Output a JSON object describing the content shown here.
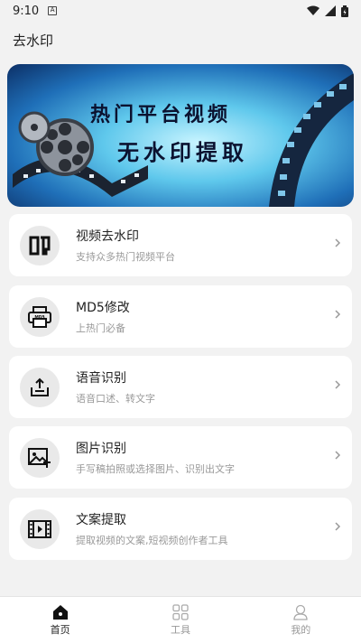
{
  "status_bar": {
    "time": "9:10"
  },
  "app_bar": {
    "title": "去水印"
  },
  "banner": {
    "line1": "热门平台视频",
    "line2": "无水印提取"
  },
  "features": [
    {
      "title": "视频去水印",
      "subtitle": "支持众多热门视频平台",
      "icon": "yin-stamp-icon"
    },
    {
      "title": "MD5修改",
      "subtitle": "上热门必备",
      "icon": "md5-printer-icon"
    },
    {
      "title": "语音识别",
      "subtitle": "语音口述、转文字",
      "icon": "upload-tray-icon"
    },
    {
      "title": "图片识别",
      "subtitle": "手写稿拍照或选择图片、识别出文字",
      "icon": "image-text-icon"
    },
    {
      "title": "文案提取",
      "subtitle": "提取视频的文案,短视频创作者工具",
      "icon": "film-icon"
    }
  ],
  "bottom_nav": [
    {
      "label": "首页",
      "icon": "home-icon",
      "active": true
    },
    {
      "label": "工具",
      "icon": "grid-icon",
      "active": false
    },
    {
      "label": "我的",
      "icon": "person-icon",
      "active": false
    }
  ],
  "colors": {
    "background": "#f2f2f2",
    "card": "#ffffff",
    "subtitle": "#999999",
    "icon_bg": "#e9e9e9"
  }
}
